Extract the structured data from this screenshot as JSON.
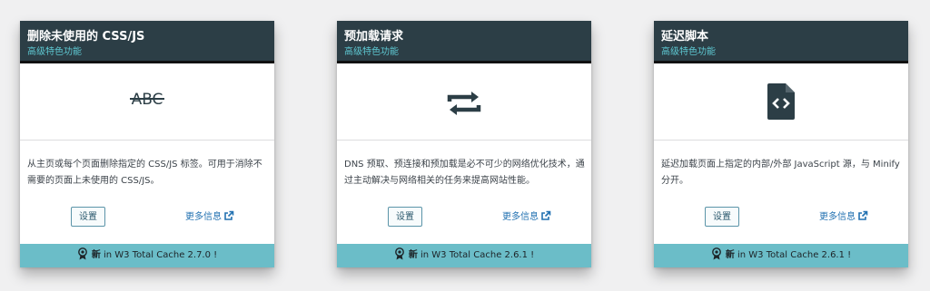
{
  "colors": {
    "header_bg": "#2c3e46",
    "subtitle": "#5ec8d2",
    "footer_bg": "#6bbdc8",
    "link": "#2271b1",
    "icon": "#2c3e46"
  },
  "cards": [
    {
      "title": "删除未使用的 CSS/JS",
      "subtitle": "高级特色功能",
      "icon": "strikethrough-abc-icon",
      "description": "从主页或每个页面删除指定的 CSS/JS 标签。可用于消除不需要的页面上未使用的 CSS/JS。",
      "settings_label": "设置",
      "more_info_label": "更多信息",
      "footer_new": "新",
      "footer_text": " in W3 Total Cache 2.7.0 !"
    },
    {
      "title": "预加载请求",
      "subtitle": "高级特色功能",
      "icon": "repeat-arrows-icon",
      "description": "DNS 预取、预连接和预加载是必不可少的网络优化技术，通过主动解决与网络相关的任务来提高网站性能。",
      "settings_label": "设置",
      "more_info_label": "更多信息",
      "footer_new": "新",
      "footer_text": " in W3 Total Cache 2.6.1 !"
    },
    {
      "title": "延迟脚本",
      "subtitle": "高级特色功能",
      "icon": "code-file-icon",
      "description": "延迟加载页面上指定的内部/外部 JavaScript 源，与 Minify 分开。",
      "settings_label": "设置",
      "more_info_label": "更多信息",
      "footer_new": "新",
      "footer_text": " in W3 Total Cache 2.6.1 !"
    }
  ]
}
